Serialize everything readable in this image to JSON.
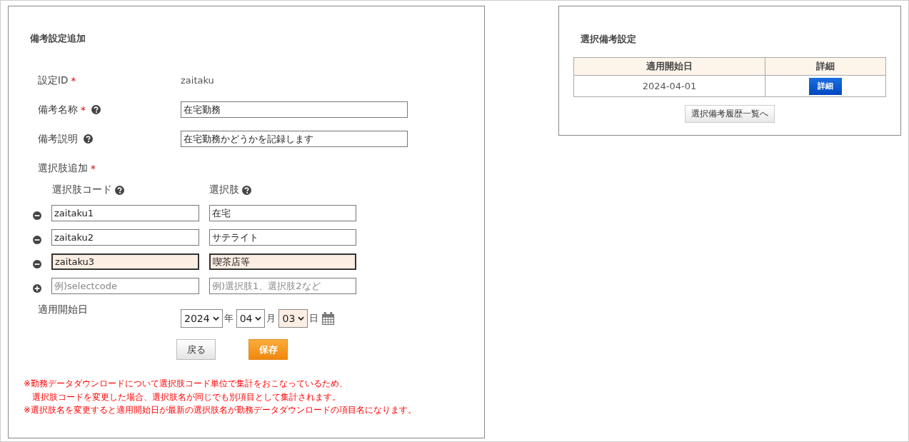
{
  "form": {
    "title": "備考設定追加",
    "setting_id": {
      "label": "設定ID",
      "required_mark": "*",
      "value": "zaitaku"
    },
    "name": {
      "label": "備考名称",
      "required_mark": "*",
      "value": "在宅勤務"
    },
    "description": {
      "label": "備考説明",
      "value": "在宅勤務かどうかを記録します"
    },
    "options": {
      "label": "選択肢追加",
      "required_mark": "*",
      "code_header": "選択肢コード",
      "choice_header": "選択肢",
      "rows": [
        {
          "kind": "remove",
          "code": "zaitaku1",
          "choice": "在宅",
          "highlighted": false
        },
        {
          "kind": "remove",
          "code": "zaitaku2",
          "choice": "サテライト",
          "highlighted": false
        },
        {
          "kind": "remove",
          "code": "zaitaku3",
          "choice": "喫茶店等",
          "highlighted": true
        },
        {
          "kind": "add",
          "code_placeholder": "例)selectcode",
          "choice_placeholder": "例)選択肢1、選択肢2など",
          "highlighted": false
        }
      ]
    },
    "start_date": {
      "label": "適用開始日",
      "parts": [
        {
          "value": "2024",
          "unit": "年",
          "highlighted": false
        },
        {
          "value": "04",
          "unit": "月",
          "highlighted": false
        },
        {
          "value": "03",
          "unit": "日",
          "highlighted": true
        }
      ]
    },
    "buttons": [
      {
        "kind": "back",
        "label": "戻る"
      },
      {
        "kind": "save",
        "label": "保存"
      }
    ],
    "notes": [
      "※勤務データダウンロードについて選択肢コード単位で集計をおこなっているため、",
      "　選択肢コードを変更した場合、選択肢名が同じでも別項目として集計されます。",
      "※選択肢名を変更すると適用開始日が最新の選択肢名が勤務データダウンロードの項目名になります。"
    ]
  },
  "history": {
    "title": "選択備考設定",
    "columns": [
      "適用開始日",
      "詳細"
    ],
    "rows": [
      {
        "date": "2024-04-01",
        "action": "詳細"
      }
    ],
    "list_button": "選択備考履歴一覧へ"
  }
}
